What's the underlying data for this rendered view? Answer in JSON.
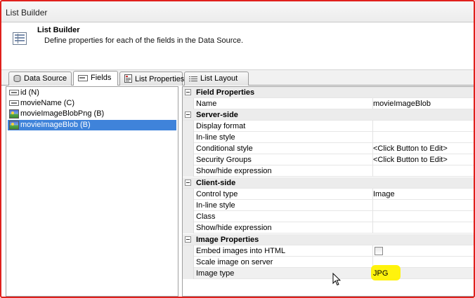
{
  "window": {
    "title": "List Builder"
  },
  "header": {
    "title": "List Builder",
    "description": "Define properties for each of the fields in the Data Source.",
    "icon": "table-icon"
  },
  "tabs": [
    {
      "label": "Data Source",
      "icon": "database-icon",
      "active": false
    },
    {
      "label": "Fields",
      "icon": "field-icon",
      "active": true
    },
    {
      "label": "List Properties",
      "icon": "properties-icon",
      "active": false
    },
    {
      "label": "List Layout",
      "icon": "layout-icon",
      "active": false
    }
  ],
  "fields": [
    {
      "label": "id (N)",
      "icon": "field-icon",
      "selected": false
    },
    {
      "label": "movieName (C)",
      "icon": "field-icon",
      "selected": false
    },
    {
      "label": "movieImageBlobPng (B)",
      "icon": "image-icon",
      "selected": false
    },
    {
      "label": "movieImageBlob (B)",
      "icon": "image-icon",
      "selected": true
    }
  ],
  "properties": {
    "field_properties": {
      "label": "Field Properties",
      "rows": [
        {
          "name": "Name",
          "value": "movieImageBlob"
        }
      ]
    },
    "server_side": {
      "label": "Server-side",
      "rows": [
        {
          "name": "Display format",
          "value": ""
        },
        {
          "name": "In-line style",
          "value": ""
        },
        {
          "name": "Conditional style",
          "value": "<Click Button to Edit>"
        },
        {
          "name": "Security Groups",
          "value": "<Click Button to Edit>"
        },
        {
          "name": "Show/hide expression",
          "value": ""
        }
      ]
    },
    "client_side": {
      "label": "Client-side",
      "rows": [
        {
          "name": "Control type",
          "value": "Image"
        },
        {
          "name": "In-line style",
          "value": ""
        },
        {
          "name": "Class",
          "value": ""
        },
        {
          "name": "Show/hide expression",
          "value": ""
        }
      ]
    },
    "image_properties": {
      "label": "Image Properties",
      "rows": [
        {
          "name": "Embed images into HTML",
          "value": "",
          "checked": false
        },
        {
          "name": "Scale image on server",
          "value": ""
        },
        {
          "name": "Image type",
          "value": "JPG"
        }
      ]
    }
  },
  "colors": {
    "frame": "#e0201c",
    "selection": "#3f83da",
    "highlight": "#fff200"
  }
}
